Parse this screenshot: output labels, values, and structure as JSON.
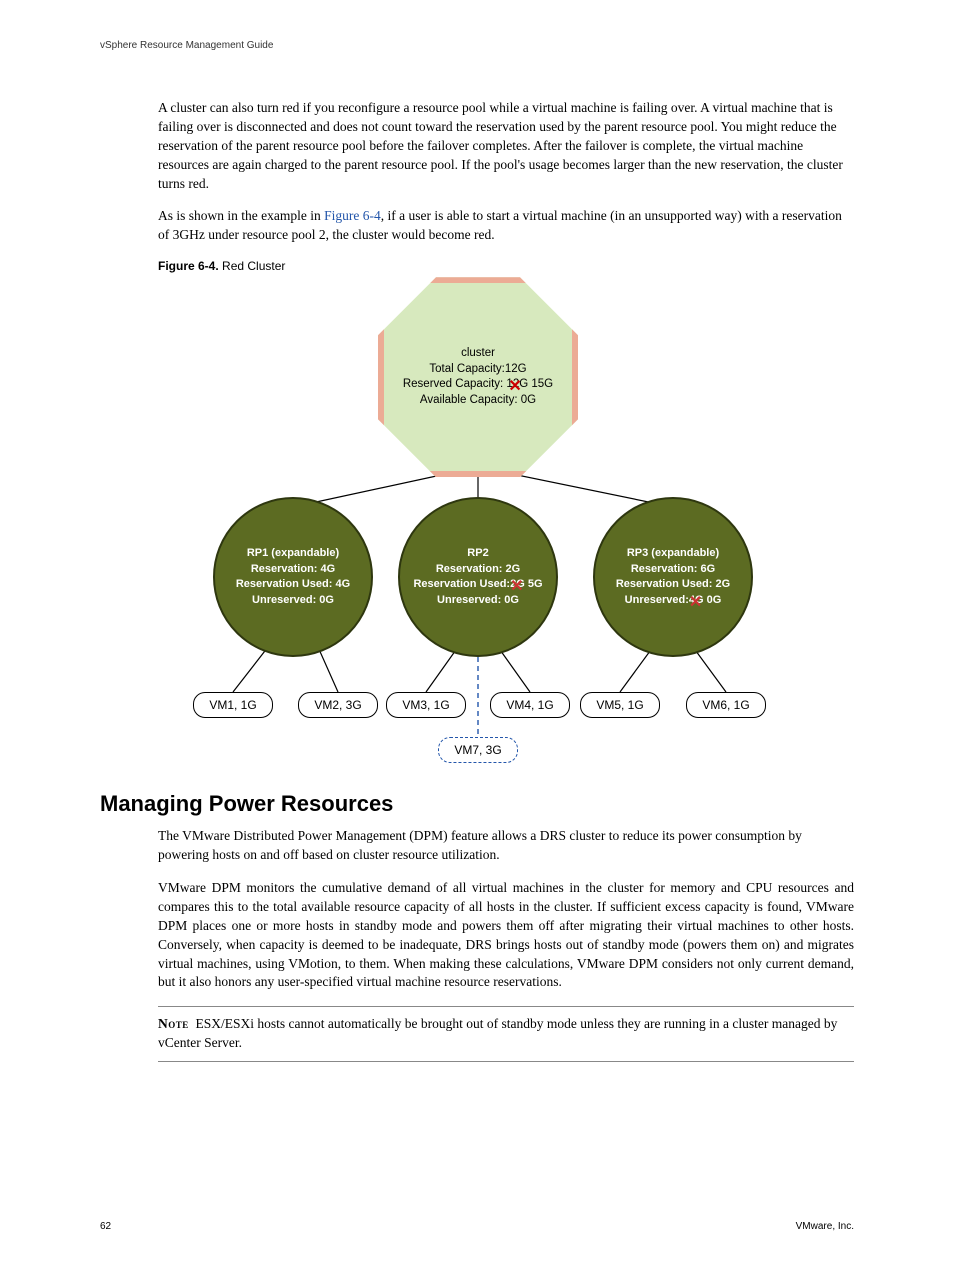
{
  "running_head": "vSphere Resource Management Guide",
  "body": {
    "p1": "A cluster can also turn red if you reconfigure a resource pool while a virtual machine is failing over. A virtual machine that is failing over is disconnected and does not count toward the reservation used by the parent resource pool. You might reduce the reservation of the parent resource pool before the failover completes. After the failover is complete, the virtual machine resources are again charged to the parent resource pool. If the pool's usage becomes larger than the new reservation, the cluster turns red.",
    "p2a": "As is shown in the example in ",
    "p2_link": "Figure 6-4",
    "p2b": ", if a user is able to start a virtual machine (in an unsupported way) with a reservation of 3GHz under resource pool 2, the cluster would become red."
  },
  "figure": {
    "label": "Figure 6-4.",
    "title": "Red Cluster"
  },
  "chart_data": {
    "type": "diagram",
    "cluster": {
      "name": "cluster",
      "total_capacity": "Total Capacity:12G",
      "reserved_old": "12G",
      "reserved_new": "15G",
      "reserved_line": "Reserved Capacity:",
      "available": "Available Capacity: 0G"
    },
    "pools": [
      {
        "id": "rp1",
        "lines": [
          "RP1 (expandable)",
          "Reservation: 4G",
          "Reservation Used: 4G",
          "Unreserved: 0G"
        ],
        "vms": [
          {
            "id": "vm1",
            "label": "VM1, 1G"
          },
          {
            "id": "vm2",
            "label": "VM2, 3G"
          }
        ]
      },
      {
        "id": "rp2",
        "lines": [
          "RP2",
          "Reservation: 2G",
          "Reservation Used:",
          "Unreserved: 0G"
        ],
        "used_old": "2G",
        "used_new": "5G",
        "vms": [
          {
            "id": "vm3",
            "label": "VM3, 1G"
          },
          {
            "id": "vm4",
            "label": "VM4, 1G"
          },
          {
            "id": "vm7",
            "label": "VM7, 3G",
            "dashed": true
          }
        ]
      },
      {
        "id": "rp3",
        "lines": [
          "RP3 (expandable)",
          "Reservation: 6G",
          "Reservation Used: 2G",
          "Unreserved:"
        ],
        "unres_old": "4G",
        "unres_new": "0G",
        "vms": [
          {
            "id": "vm5",
            "label": "VM5, 1G"
          },
          {
            "id": "vm6",
            "label": "VM6, 1G"
          }
        ]
      }
    ]
  },
  "section": {
    "heading": "Managing Power Resources",
    "p1": "The VMware Distributed Power Management (DPM) feature allows a DRS cluster to reduce its power consumption by powering hosts on and off based on cluster resource utilization.",
    "p2": "VMware DPM monitors the cumulative demand of all virtual machines in the cluster for memory and CPU resources and compares this to the total available resource capacity of all hosts in the cluster. If sufficient excess capacity is found, VMware DPM places one or more hosts in standby mode and powers them off after migrating their virtual machines to other hosts. Conversely, when capacity is deemed to be inadequate, DRS brings hosts out of standby mode (powers them on) and migrates virtual machines, using VMotion, to them. When making these calculations, VMware DPM considers not only current demand, but it also honors any user-specified virtual machine resource reservations.",
    "note_label": "Note",
    "note_text": "ESX/ESXi hosts cannot automatically be brought out of standby mode unless they are running in a cluster managed by vCenter Server."
  },
  "footer": {
    "page": "62",
    "org": "VMware, Inc."
  }
}
